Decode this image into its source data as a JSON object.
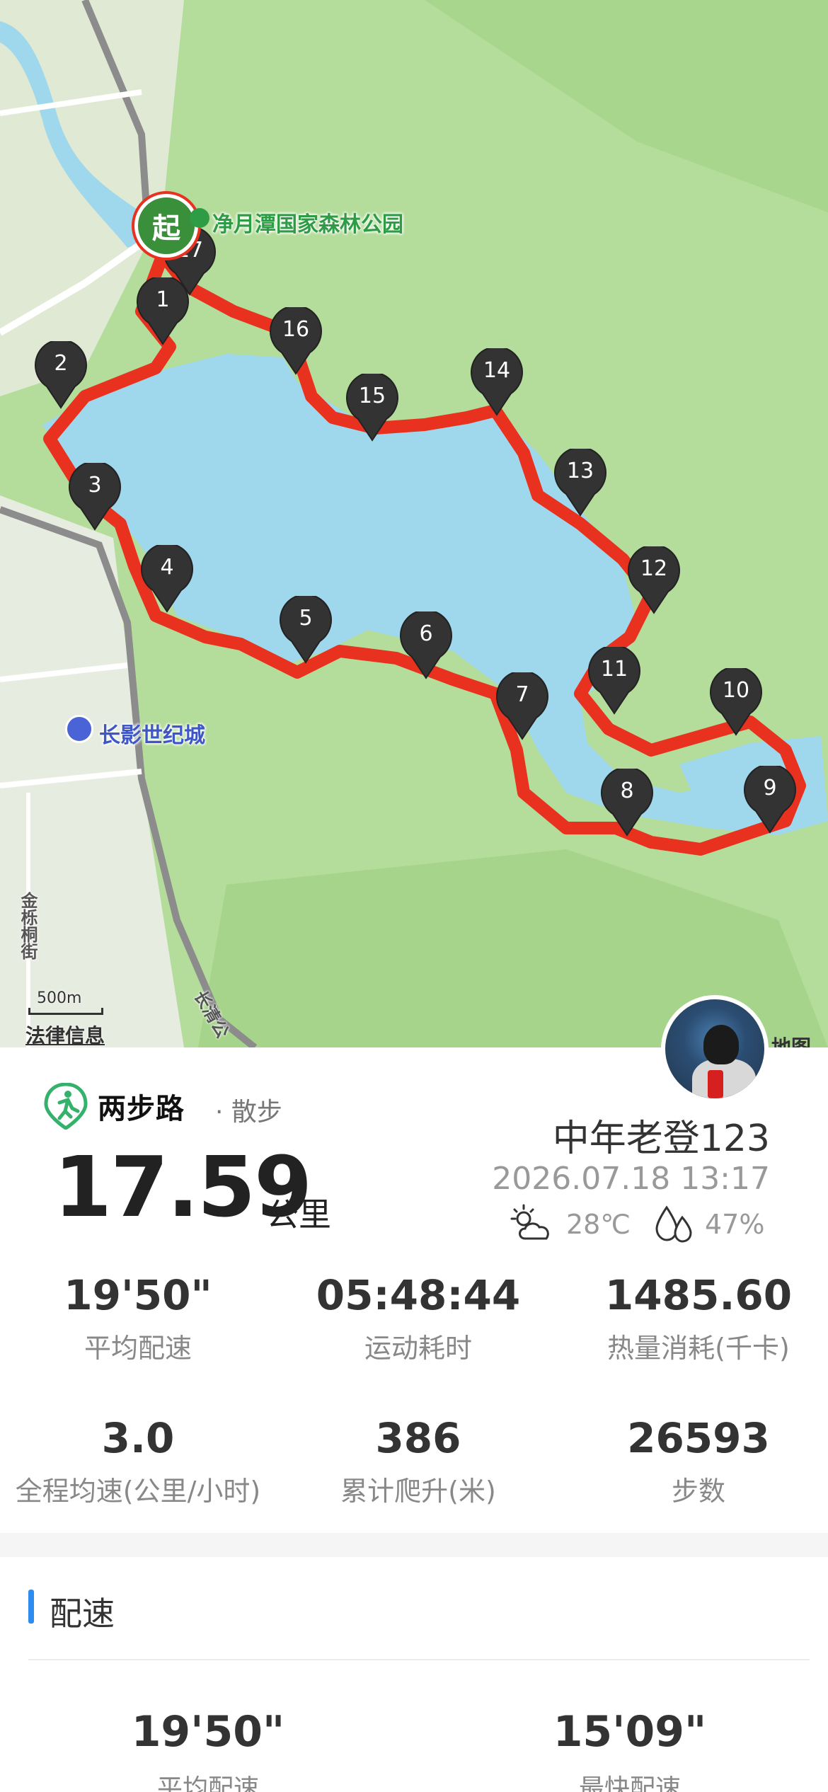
{
  "map": {
    "park_label": "净月潭国家森林公园",
    "city_label": "长影世纪城",
    "street_label": "金栎桐街",
    "road_label": "长清公",
    "scale_label": "500m",
    "legal_label": "法律信息",
    "map_brand": "地图",
    "start_marker": "起",
    "waypoints": [
      "1",
      "2",
      "3",
      "4",
      "5",
      "6",
      "7",
      "8",
      "9",
      "10",
      "11",
      "12",
      "13",
      "14",
      "15",
      "16",
      "17"
    ],
    "colors": {
      "route": "#e8311e",
      "water": "#9fd8ec",
      "land": "#b4dc9a",
      "marker": "#333333",
      "start": "#3a8f3a"
    }
  },
  "card": {
    "brand_name": "两步路",
    "brand_sub": "· 散步",
    "distance": "17.59",
    "distance_unit": "公里",
    "user_name": "中年老登123",
    "date": "2026.07.18 13:17",
    "temperature": "28℃",
    "humidity": "47%",
    "stats": [
      {
        "value": "19'50\"",
        "label": "平均配速"
      },
      {
        "value": "05:48:44",
        "label": "运动耗时"
      },
      {
        "value": "1485.60",
        "label": "热量消耗(千卡)"
      },
      {
        "value": "3.0",
        "label": "全程均速(公里/小时)"
      },
      {
        "value": "386",
        "label": "累计爬升(米)"
      },
      {
        "value": "26593",
        "label": "步数"
      }
    ]
  },
  "pace": {
    "title": "配速",
    "avg_value": "19'50\"",
    "avg_label": "平均配速",
    "fast_value": "15'09\"",
    "fast_label": "最快配速"
  }
}
